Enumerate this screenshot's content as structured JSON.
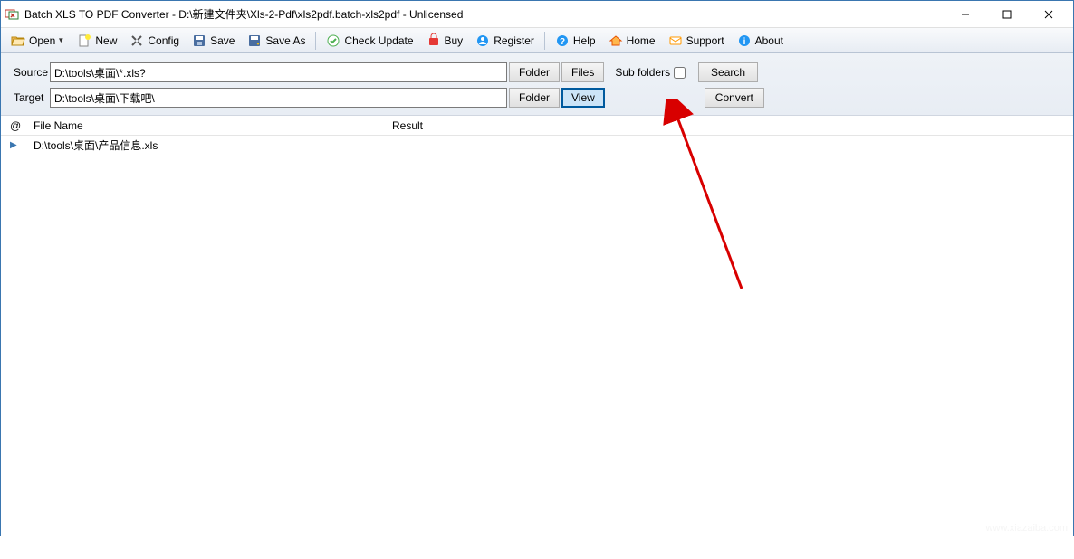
{
  "window": {
    "title": "Batch XLS TO PDF Converter - D:\\新建文件夹\\Xls-2-Pdf\\xls2pdf.batch-xls2pdf - Unlicensed"
  },
  "toolbar": {
    "open": "Open",
    "new": "New",
    "config": "Config",
    "save": "Save",
    "saveas": "Save As",
    "check": "Check Update",
    "buy": "Buy",
    "register": "Register",
    "help": "Help",
    "home": "Home",
    "support": "Support",
    "about": "About"
  },
  "form": {
    "source_label": "Source",
    "source_value": "D:\\tools\\桌面\\*.xls?",
    "target_label": "Target",
    "target_value": "D:\\tools\\桌面\\下载吧\\",
    "folder_btn": "Folder",
    "files_btn": "Files",
    "view_btn": "View",
    "subfolders_label": "Sub folders",
    "search_btn": "Search",
    "convert_btn": "Convert"
  },
  "columns": {
    "at": "@",
    "filename": "File Name",
    "result": "Result"
  },
  "rows": [
    {
      "filename": "D:\\tools\\桌面\\产品信息.xls",
      "result": ""
    }
  ],
  "watermark": "www.xiazaiba.com"
}
